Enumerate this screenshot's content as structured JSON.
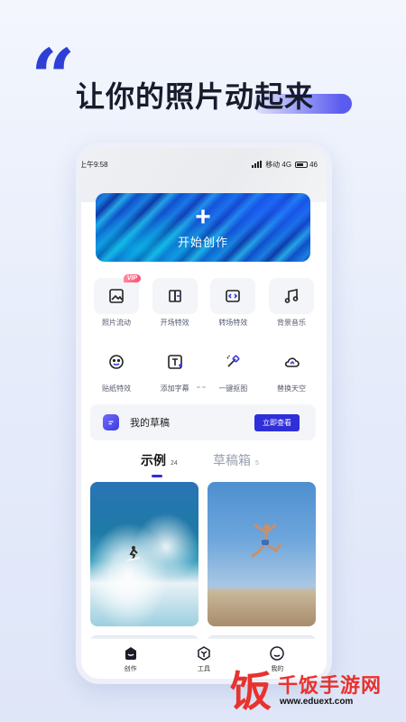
{
  "headline": "让你的照片动起来",
  "status_bar": {
    "time": "上午9:58",
    "carrier": "移动 4G",
    "battery": "46"
  },
  "hero": {
    "icon": "plus-icon",
    "label": "开始创作"
  },
  "tools": [
    {
      "label": "照片流动",
      "icon": "image-icon",
      "badge": "VIP"
    },
    {
      "label": "开场特效",
      "icon": "opening-effect-icon"
    },
    {
      "label": "转场特效",
      "icon": "transition-icon"
    },
    {
      "label": "背景音乐",
      "icon": "music-icon"
    },
    {
      "label": "贴纸特效",
      "icon": "sticker-icon"
    },
    {
      "label": "添加字幕",
      "icon": "subtitle-icon"
    },
    {
      "label": "一键抠图",
      "icon": "magic-cutout-icon"
    },
    {
      "label": "替换天空",
      "icon": "cloud-icon"
    }
  ],
  "drafts": {
    "label": "我的草稿",
    "button": "立即查看"
  },
  "tabs": [
    {
      "name": "示例",
      "count": "24",
      "active": true
    },
    {
      "name": "草稿箱",
      "count": "5",
      "active": false
    }
  ],
  "gallery": [
    {
      "scene": "surfer riding wave"
    },
    {
      "scene": "person jumping on beach"
    }
  ],
  "bottom_nav": [
    {
      "label": "创作",
      "icon": "create-icon",
      "active": true
    },
    {
      "label": "工具",
      "icon": "tools-icon"
    },
    {
      "label": "我的",
      "icon": "profile-icon"
    }
  ],
  "watermark": {
    "logo_char": "饭",
    "name": "千饭手游网",
    "url": "www.eduext.com"
  },
  "colors": {
    "accent": "#2f2fd9",
    "quote": "#2f3ed6",
    "watermark": "#e8322e"
  }
}
